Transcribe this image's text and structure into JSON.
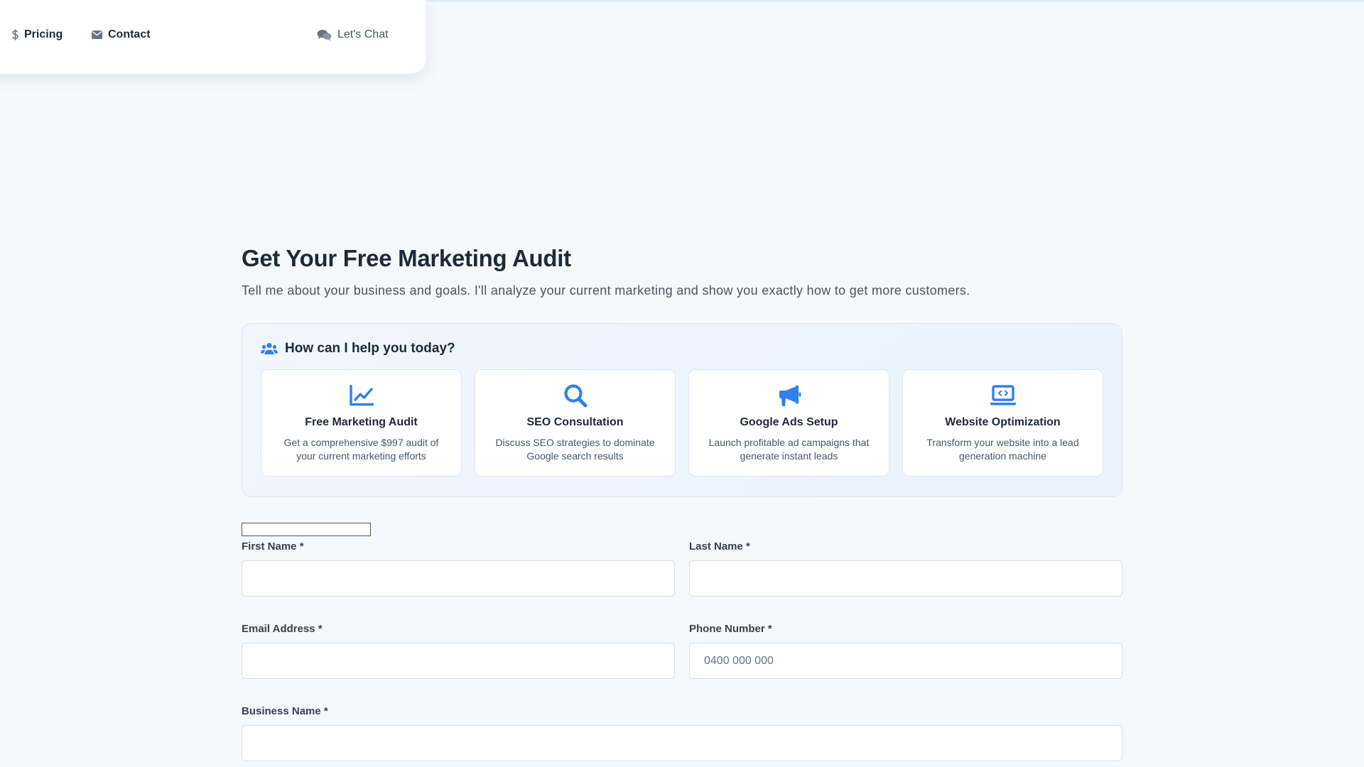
{
  "nav": {
    "pricing_icon": "dollar-icon",
    "pricing_label": "Pricing",
    "contact_icon": "envelope-icon",
    "contact_label": "Contact",
    "chat_icon": "chat-bubbles-icon",
    "chat_label": "Let's Chat"
  },
  "hero": {
    "title": "Get Your Free Marketing Audit",
    "subtitle": "Tell me about your business and goals. I'll analyze your current marketing and show you exactly how to get more customers."
  },
  "help": {
    "icon": "users-icon",
    "heading": "How can I help you today?",
    "accent_color": "#2f80ed",
    "services": [
      {
        "icon": "chart-line-icon",
        "title": "Free Marketing Audit",
        "description": "Get a comprehensive $997 audit of your current marketing efforts"
      },
      {
        "icon": "search-icon",
        "title": "SEO Consultation",
        "description": "Discuss SEO strategies to dominate Google search results"
      },
      {
        "icon": "megaphone-icon",
        "title": "Google Ads Setup",
        "description": "Launch profitable ad campaigns that generate instant leads"
      },
      {
        "icon": "laptop-code-icon",
        "title": "Website Optimization",
        "description": "Transform your website into a lead generation machine"
      }
    ]
  },
  "form": {
    "first_name": {
      "label": "First Name *",
      "value": "",
      "placeholder": ""
    },
    "last_name": {
      "label": "Last Name *",
      "value": "",
      "placeholder": ""
    },
    "email": {
      "label": "Email Address *",
      "value": "",
      "placeholder": ""
    },
    "phone": {
      "label": "Phone Number *",
      "value": "",
      "placeholder": "0400 000 000"
    },
    "business_name": {
      "label": "Business Name *",
      "value": "",
      "placeholder": ""
    }
  }
}
